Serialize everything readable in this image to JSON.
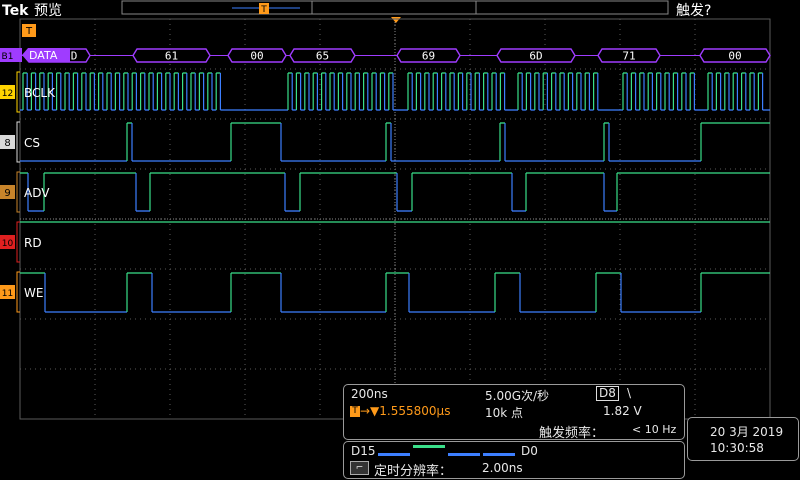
{
  "header": {
    "brand": "Tek",
    "mode": "预览",
    "trigger_status": "触发?"
  },
  "trigger_marker": "T",
  "channels": [
    {
      "badge": "B1",
      "name": "DATA",
      "color": "#9f3cff",
      "kind": "bus"
    },
    {
      "badge": "12",
      "name": "BCLK",
      "color": "#ffd400",
      "kind": "digital"
    },
    {
      "badge": "8",
      "name": "CS",
      "color": "#d9d9d9",
      "kind": "digital"
    },
    {
      "badge": "9",
      "name": "ADV",
      "color": "#c8842a",
      "kind": "digital"
    },
    {
      "badge": "10",
      "name": "RD",
      "color": "#e02020",
      "kind": "digital"
    },
    {
      "badge": "11",
      "name": "WE",
      "color": "#ff9a1a",
      "kind": "digital"
    }
  ],
  "bus_values": [
    "D",
    "61",
    "00",
    "65",
    "69",
    "6D",
    "71",
    "00"
  ],
  "acquisition": {
    "timebase": "200ns",
    "sample_rate": "5.00G次/秒",
    "trigger_source": "D8",
    "trigger_slope": "\\",
    "trigger_delay": "1.555800µs",
    "record_length": "10k 点",
    "trigger_level": "1.82 V",
    "trigger_freq_label": "触发频率：",
    "trigger_freq_value": "< 10 Hz"
  },
  "digital_panel": {
    "label_high": "D15",
    "label_low": "D0",
    "timing_res_label": "定时分辨率：",
    "timing_res_value": "2.00ns"
  },
  "clock": {
    "date": "20 3月 2019",
    "time": "10:30:58"
  },
  "colors": {
    "high": "#3adf8a",
    "low": "#3d7fff",
    "bus": "#9f3cff",
    "grid": "#5a5a5a",
    "trigger": "#ff9a1a"
  }
}
